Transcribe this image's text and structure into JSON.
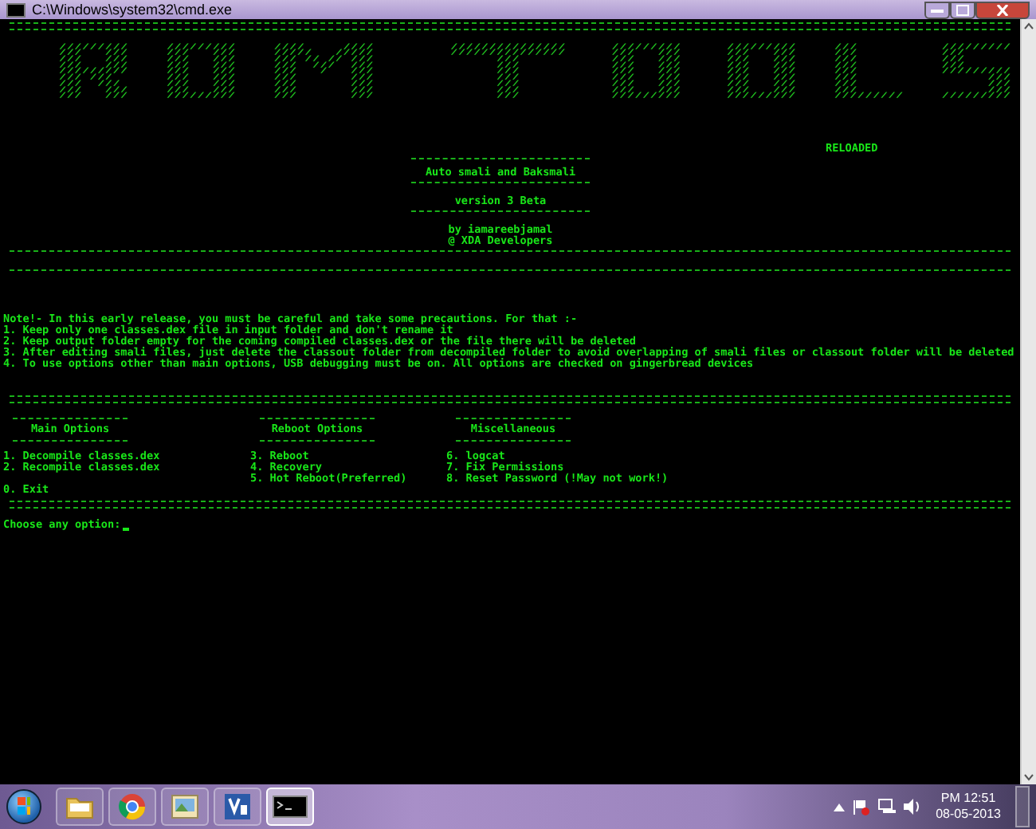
{
  "window": {
    "title": "C:\\Windows\\system32\\cmd.exe"
  },
  "console": {
    "banner": [
      "      /////////     /////////     ////     ////          ///////////////      /////////      /////////     ///           /////////",
      "      ///   ///     ///   ///     /////   /////          ///////////////      ///   ///      ///   ///     ///           ///",
      "      ///   ///     ///   ///     /// // // ///                ///            ///   ///      ///   ///     ///           ///",
      "      ///   ///     ///   ///     ///  ///  ///                ///            ///   ///      ///   ///     ///           ///",
      "      /////////     ///   ///     ///   /   ///                ///            ///   ///      ///   ///     ///           /////////",
      "      /// ///       ///   ///     ///       ///                ///            ///   ///      ///   ///     ///                 ///",
      "      ///  ///      ///   ///     ///       ///                ///            ///   ///      ///   ///     ///                 ///",
      "      ///   ///     ///   ///     ///       ///                ///            ///   ///      ///   ///     ///                 ///",
      "      ///   ///     /////////     ///       ///                ///            /////////      /////////     /////////     /////////"
    ],
    "banner_tag": "RELOADED",
    "subtitle": "Auto smali and Baksmali",
    "version": "version 3 Beta",
    "credits": [
      "by iamareebjamal",
      "@ XDA Developers"
    ],
    "notes": [
      "Note!- In this early release, you must be careful and take some precautions. For that :-",
      "1. Keep only one classes.dex file in input folder and don't rename it",
      "2. Keep output folder empty for the coming compiled classes.dex or the file there will be deleted",
      "3. After editing smali files, just delete the classout folder from decompiled folder to avoid overlapping of smali files or classout folder will be deleted",
      "4. To use options other than main options, USB debugging must be on. All options are checked on gingerbread devices"
    ],
    "menus": [
      {
        "heading": "Main Options",
        "items": [
          "1. Decompile classes.dex",
          "2. Recompile classes.dex"
        ]
      },
      {
        "heading": "Reboot Options",
        "items": [
          "3. Reboot",
          "4. Recovery",
          "5. Hot Reboot(Preferred)"
        ]
      },
      {
        "heading": "Miscellaneous",
        "items": [
          "6. logcat",
          "7. Fix Permissions",
          "8. Reset Password (!May not work!)"
        ]
      }
    ],
    "exit_option": "0. Exit",
    "prompt": "Choose any option:"
  },
  "taskbar": {
    "apps": [
      {
        "kind": "folder",
        "active": false
      },
      {
        "kind": "browser",
        "active": false
      },
      {
        "kind": "picture",
        "active": false
      },
      {
        "kind": "studio",
        "active": false
      },
      {
        "kind": "console",
        "active": true
      }
    ],
    "clock": {
      "time": "PM 12:51",
      "date": "08-05-2013"
    }
  }
}
